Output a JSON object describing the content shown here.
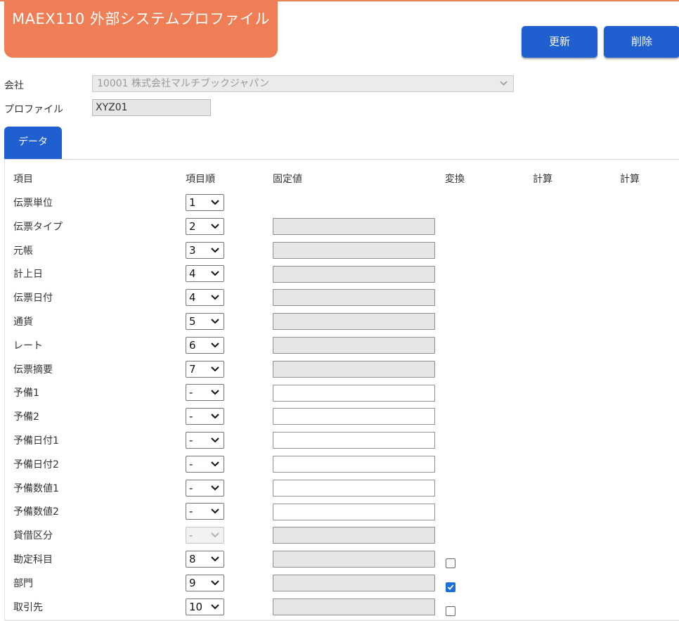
{
  "header": {
    "title": "MAEX110 外部システムプロファイル",
    "update_label": "更新",
    "delete_label": "削除"
  },
  "form": {
    "company_label": "会社",
    "company_value": "10001 株式会社マルチブックジャパン",
    "profile_label": "プロファイル",
    "profile_value": "XYZ01"
  },
  "tabs": [
    {
      "label": "データ",
      "active": true
    }
  ],
  "table": {
    "headers": [
      "項目",
      "項目順",
      "固定値",
      "変換",
      "計算",
      "計算"
    ],
    "rows": [
      {
        "label": "伝票単位",
        "order": "1",
        "order_disabled": false,
        "fixed": "none",
        "check": "none"
      },
      {
        "label": "伝票タイプ",
        "order": "2",
        "order_disabled": false,
        "fixed": "readonly",
        "check": "none"
      },
      {
        "label": "元帳",
        "order": "3",
        "order_disabled": false,
        "fixed": "readonly",
        "check": "none"
      },
      {
        "label": "計上日",
        "order": "4",
        "order_disabled": false,
        "fixed": "readonly",
        "check": "none"
      },
      {
        "label": "伝票日付",
        "order": "4",
        "order_disabled": false,
        "fixed": "readonly",
        "check": "none"
      },
      {
        "label": "通貨",
        "order": "5",
        "order_disabled": false,
        "fixed": "readonly",
        "check": "none"
      },
      {
        "label": "レート",
        "order": "6",
        "order_disabled": false,
        "fixed": "readonly",
        "check": "none"
      },
      {
        "label": "伝票摘要",
        "order": "7",
        "order_disabled": false,
        "fixed": "readonly",
        "check": "none"
      },
      {
        "label": "予備1",
        "order": "-",
        "order_disabled": false,
        "fixed": "editable",
        "check": "none"
      },
      {
        "label": "予備2",
        "order": "-",
        "order_disabled": false,
        "fixed": "editable",
        "check": "none"
      },
      {
        "label": "予備日付1",
        "order": "-",
        "order_disabled": false,
        "fixed": "editable",
        "check": "none"
      },
      {
        "label": "予備日付2",
        "order": "-",
        "order_disabled": false,
        "fixed": "editable",
        "check": "none"
      },
      {
        "label": "予備数値1",
        "order": "-",
        "order_disabled": false,
        "fixed": "editable",
        "check": "none"
      },
      {
        "label": "予備数値2",
        "order": "-",
        "order_disabled": false,
        "fixed": "editable",
        "check": "none"
      },
      {
        "label": "貸借区分",
        "order": "-",
        "order_disabled": true,
        "fixed": "readonly",
        "check": "none"
      },
      {
        "label": "勘定科目",
        "order": "8",
        "order_disabled": false,
        "fixed": "readonly",
        "check": "unchecked"
      },
      {
        "label": "部門",
        "order": "9",
        "order_disabled": false,
        "fixed": "readonly",
        "check": "checked"
      },
      {
        "label": "取引先",
        "order": "10",
        "order_disabled": false,
        "fixed": "readonly",
        "check": "unchecked"
      }
    ]
  },
  "icons": {
    "dropdown": "chevron-down-icon",
    "check": "check-icon"
  },
  "colors": {
    "title_bg": "#ef7d55",
    "button_bg": "#1f5fcf",
    "checkbox_checked": "#1d6fd8"
  }
}
